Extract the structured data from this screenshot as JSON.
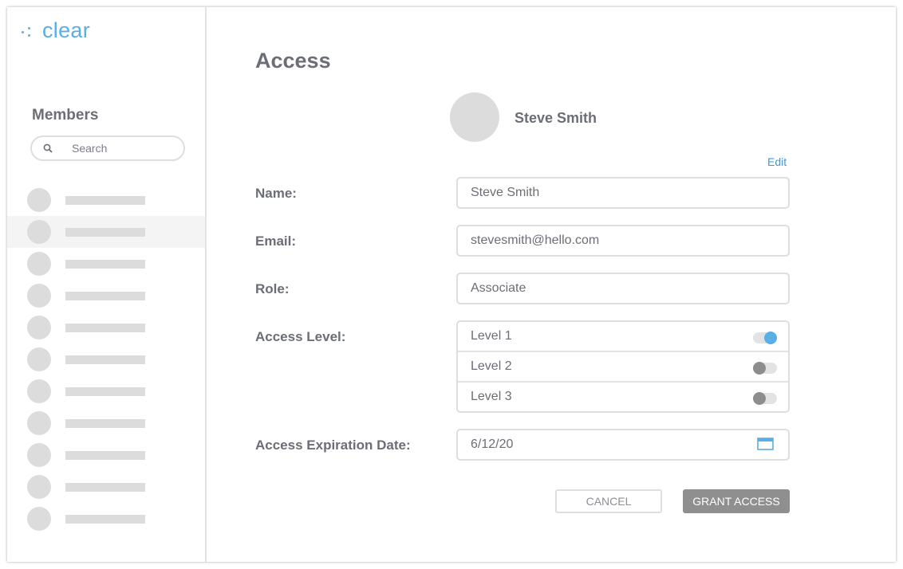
{
  "app": {
    "logo_text": "clear"
  },
  "sidebar": {
    "title": "Members",
    "search": {
      "placeholder": "Search",
      "icon": "search-icon"
    },
    "member_count": 11,
    "selected_index": 1
  },
  "main": {
    "title": "Access",
    "profile": {
      "name": "Steve Smith",
      "edit_label": "Edit"
    },
    "form": {
      "name_label": "Name:",
      "name_value": "Steve Smith",
      "email_label": "Email:",
      "email_value": "stevesmith@hello.com",
      "role_label": "Role:",
      "role_value": "Associate",
      "access_level_label": "Access Level:",
      "levels": [
        {
          "label": "Level 1",
          "enabled": true
        },
        {
          "label": "Level 2",
          "enabled": false
        },
        {
          "label": "Level 3",
          "enabled": false
        }
      ],
      "expiration_label": "Access Expiration Date:",
      "expiration_value": "6/12/20"
    },
    "buttons": {
      "cancel": "CANCEL",
      "grant": "GRANT ACCESS"
    }
  },
  "colors": {
    "accent": "#5aaee6",
    "link": "#3a9ad9",
    "primary_button": "#8f8f8f"
  }
}
